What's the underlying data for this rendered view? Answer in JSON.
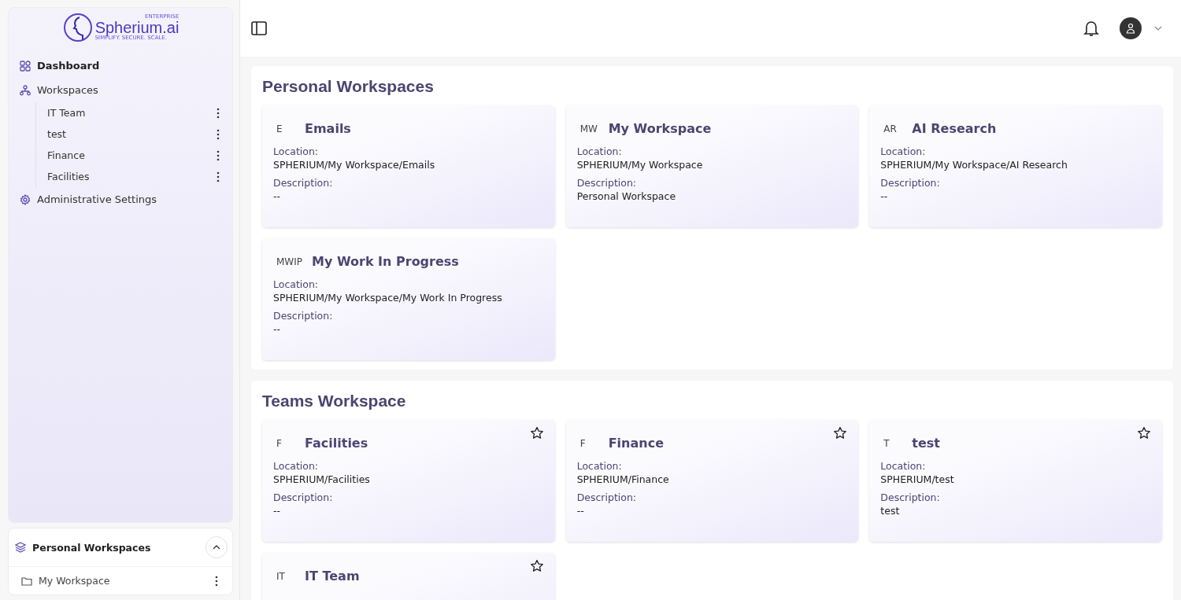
{
  "logo": {
    "name": "Spherium.ai",
    "badge": "ENTERPRISE",
    "tagline": "SIMPLIFY. SECURE. SCALE."
  },
  "nav": [
    {
      "label": "Dashboard",
      "selected": true
    },
    {
      "label": "Workspaces",
      "selected": false,
      "children": [
        {
          "label": "IT Team"
        },
        {
          "label": "test"
        },
        {
          "label": "Finance"
        },
        {
          "label": "Facilities"
        }
      ]
    },
    {
      "label": "Administrative Settings",
      "selected": false
    }
  ],
  "personal_panel": {
    "title": "Personal Workspaces",
    "expanded": true,
    "items": [
      {
        "label": "My Workspace"
      }
    ]
  },
  "sections": [
    {
      "title": "Personal Workspaces",
      "favoritable": false,
      "cards": [
        {
          "abbr": "E",
          "title": "Emails",
          "location_label": "Location:",
          "location": "SPHERIUM/My Workspace/Emails",
          "description_label": "Description:",
          "description": "--"
        },
        {
          "abbr": "MW",
          "title": "My Workspace",
          "location_label": "Location:",
          "location": "SPHERIUM/My Workspace",
          "description_label": "Description:",
          "description": "Personal Workspace"
        },
        {
          "abbr": "AR",
          "title": "AI Research",
          "location_label": "Location:",
          "location": "SPHERIUM/My Workspace/AI Research",
          "description_label": "Description:",
          "description": "--"
        },
        {
          "abbr": "MWIP",
          "title": "My Work In Progress",
          "location_label": "Location:",
          "location": "SPHERIUM/My Workspace/My Work In Progress",
          "description_label": "Description:",
          "description": "--"
        }
      ]
    },
    {
      "title": "Teams Workspace",
      "favoritable": true,
      "cards": [
        {
          "abbr": "F",
          "title": "Facilities",
          "location_label": "Location:",
          "location": "SPHERIUM/Facilities",
          "description_label": "Description:",
          "description": "--"
        },
        {
          "abbr": "F",
          "title": "Finance",
          "location_label": "Location:",
          "location": "SPHERIUM/Finance",
          "description_label": "Description:",
          "description": "--"
        },
        {
          "abbr": "T",
          "title": "test",
          "location_label": "Location:",
          "location": "SPHERIUM/test",
          "description_label": "Description:",
          "description": "test"
        },
        {
          "abbr": "IT",
          "title": "IT Team"
        }
      ]
    }
  ]
}
